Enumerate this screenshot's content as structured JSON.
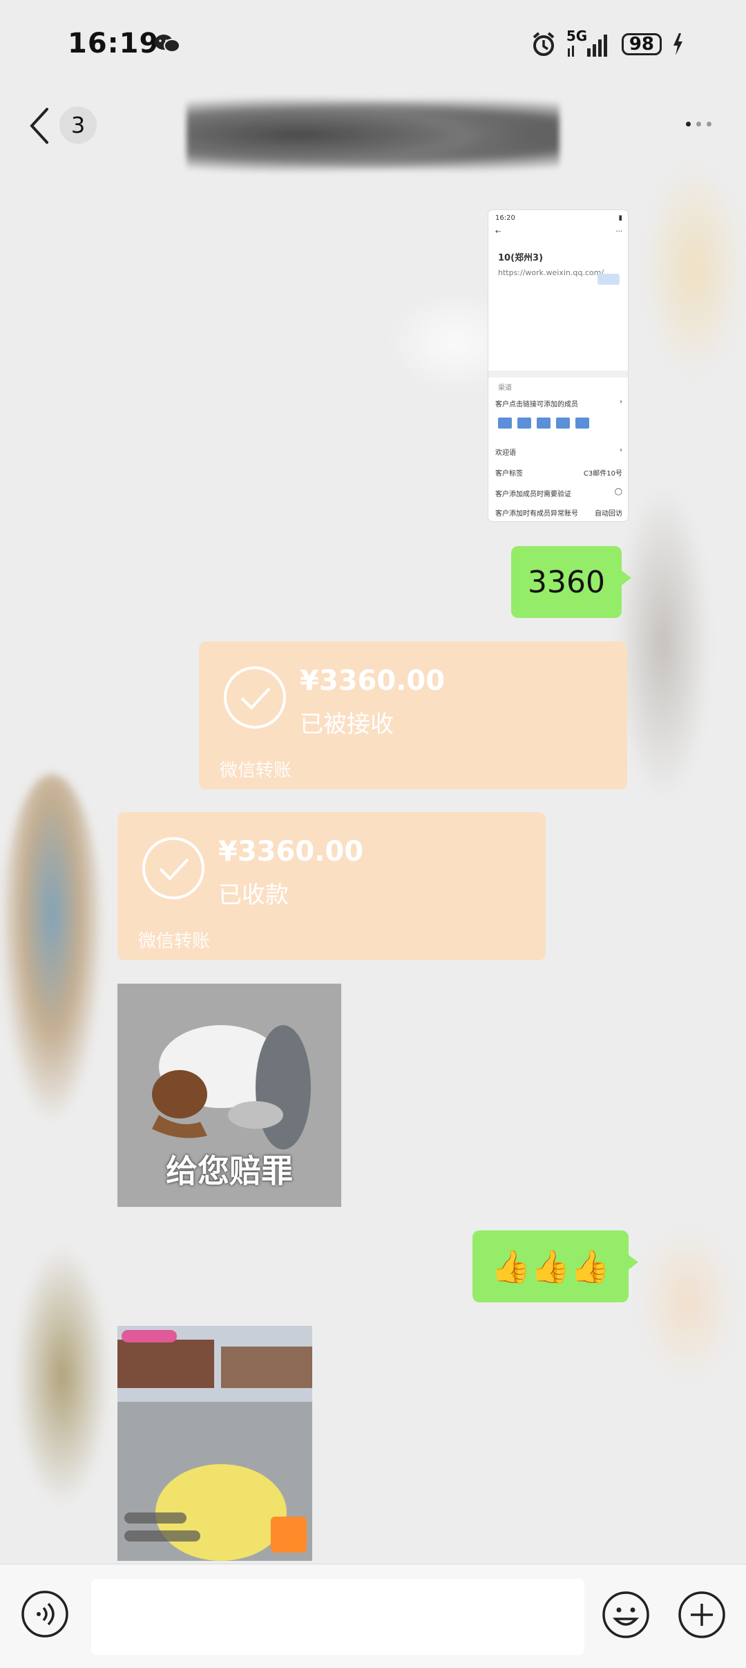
{
  "status_bar": {
    "time": "16:19",
    "network": "5G",
    "battery": "98",
    "icons": [
      "wechat-icon",
      "alarm-icon",
      "signal-icon",
      "charging-icon"
    ]
  },
  "header": {
    "unread_count": "3",
    "back_icon": "chevron-left-icon",
    "more_icon": "more-dots-icon"
  },
  "messages": {
    "screenshot": {
      "time": "16:20",
      "title": "10(郑州3)",
      "url": "https://work.weixin.qq.com/...",
      "section": "渠道",
      "rows": [
        "客户点击链接可添加的成员",
        "欢迎语",
        "客户标签",
        "客户添加成员时需要验证",
        "客户添加时有成员异常账号"
      ],
      "tag_value": "C3邮件10号",
      "last_value": "自动回访"
    },
    "sent_text": "3360",
    "transfer_received": {
      "amount": "¥3360.00",
      "status": "已被接收",
      "footer": "微信转账"
    },
    "transfer_collected": {
      "amount": "¥3360.00",
      "status": "已收款",
      "footer": "微信转账"
    },
    "sticker_caption": "给您赔罪",
    "thumbs_text": "👍👍👍"
  },
  "input_bar": {
    "voice_icon": "voice-icon",
    "emoji_icon": "emoji-icon",
    "plus_icon": "plus-icon"
  },
  "colors": {
    "background": "#ededed",
    "sent_bubble": "#95ec69",
    "transfer_bubble": "#fbdfc3"
  }
}
